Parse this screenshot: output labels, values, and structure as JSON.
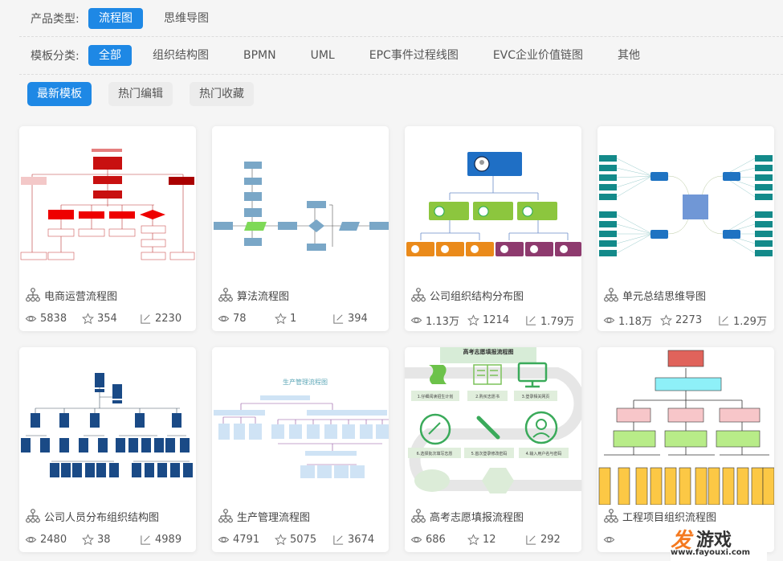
{
  "filters": {
    "product_type": {
      "label": "产品类型:",
      "options": [
        {
          "label": "流程图",
          "active": true
        },
        {
          "label": "思维导图",
          "active": false
        }
      ]
    },
    "category": {
      "label": "模板分类:",
      "options": [
        {
          "label": "全部",
          "active": true
        },
        {
          "label": "组织结构图",
          "active": false
        },
        {
          "label": "BPMN",
          "active": false
        },
        {
          "label": "UML",
          "active": false
        },
        {
          "label": "EPC事件过程线图",
          "active": false
        },
        {
          "label": "EVC企业价值链图",
          "active": false
        },
        {
          "label": "其他",
          "active": false
        }
      ]
    },
    "sort": [
      {
        "label": "最新模板",
        "active": true
      },
      {
        "label": "热门编辑",
        "active": false
      },
      {
        "label": "热门收藏",
        "active": false
      }
    ]
  },
  "colors": {
    "accent": "#1e88e5"
  },
  "templates": [
    {
      "title": "电商运营流程图",
      "views": "5838",
      "stars": "354",
      "edits": "2230",
      "thumbnail": "red-flowchart"
    },
    {
      "title": "算法流程图",
      "views": "78",
      "stars": "1",
      "edits": "394",
      "thumbnail": "blue-algorithm-flowchart"
    },
    {
      "title": "公司组织结构分布图",
      "views": "1.13万",
      "stars": "1214",
      "edits": "1.79万",
      "thumbnail": "colored-org-chart"
    },
    {
      "title": "单元总结思维导图",
      "views": "1.18万",
      "stars": "2273",
      "edits": "1.29万",
      "thumbnail": "teal-mindmap"
    },
    {
      "title": "公司人员分布组织结构图",
      "views": "2480",
      "stars": "38",
      "edits": "4989",
      "thumbnail": "navy-org-chart"
    },
    {
      "title": "生产管理流程图",
      "views": "4791",
      "stars": "5075",
      "edits": "3674",
      "thumbnail": "production-flowchart",
      "thumb_title": "生产管理流程图"
    },
    {
      "title": "高考志愿填报流程图",
      "views": "686",
      "stars": "12",
      "edits": "292",
      "thumbnail": "green-step-infographic",
      "thumb_title": "高考志愿填报流程图",
      "steps": [
        "1.仔细阅读招生计划",
        "2.购买志愿书",
        "3.登录相关网页",
        "4.输入用户名与密码",
        "5.首次登录修改密码",
        "6.选择批次填写志愿"
      ]
    },
    {
      "title": "工程项目组织流程图",
      "views": "",
      "stars": "",
      "edits": "",
      "thumbnail": "yellow-org-flowchart"
    }
  ],
  "watermark": {
    "brand_a": "发",
    "brand_b": "游戏",
    "url": "www.fayouxi.com"
  }
}
